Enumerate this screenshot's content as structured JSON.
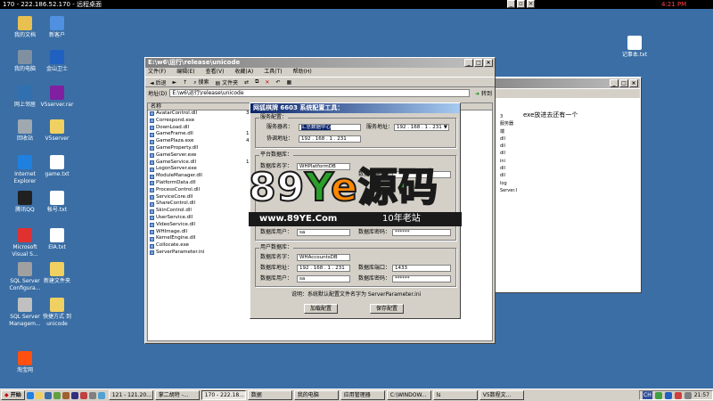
{
  "rdp": {
    "title": "170 - 222.186.52.170 - 远程桌面",
    "clock_red": "4:21 PM"
  },
  "desktop_icons": [
    {
      "label": "我的文档",
      "color": "#e8c050"
    },
    {
      "label": "新客户",
      "color": "#5090e0"
    },
    {
      "label": "我的电脑",
      "color": "#8090a0"
    },
    {
      "label": "金山卫士",
      "color": "#2060c0"
    },
    {
      "label": "网上邻居",
      "color": "#3070b0"
    },
    {
      "label": "V5server.rar",
      "color": "#8020a0"
    },
    {
      "label": "回收站",
      "color": "#a0a8b0"
    },
    {
      "label": "V5server",
      "color": "#f0d060"
    },
    {
      "label": "Internet\nExplorer",
      "color": "#2080e0"
    },
    {
      "label": "game.txt",
      "color": "#ffffff"
    },
    {
      "label": "腾讯QQ",
      "color": "#202020"
    },
    {
      "label": "帐号.txt",
      "color": "#ffffff"
    },
    {
      "label": "Microsoft\nVisual S...",
      "color": "#e03030"
    },
    {
      "label": "ElA.txt",
      "color": "#ffffff"
    },
    {
      "label": "SQL Server\nConfigura...",
      "color": "#a0a0a0"
    },
    {
      "label": "新建文件夹",
      "color": "#f0d060"
    },
    {
      "label": "SQL Server\nManagem...",
      "color": "#c0c0c0"
    },
    {
      "label": "快捷方式 到\nunicode",
      "color": "#f0d060"
    },
    {
      "label": "淘宝网",
      "color": "#ff5010"
    },
    {
      "label": "记事本.txt",
      "color": "#ffffff"
    }
  ],
  "explorer": {
    "title": "E:\\w6\\运行\\release\\unicode",
    "menu": [
      "文件(F)",
      "编辑(E)",
      "查看(V)",
      "收藏(A)",
      "工具(T)",
      "帮助(H)"
    ],
    "toolbar": {
      "back": "后退",
      "search": "搜索",
      "folders": "文件夹"
    },
    "address_label": "地址(D)",
    "address_value": "E:\\w6\\运行\\release\\unicode",
    "go_label": "转到",
    "column_name": "名称",
    "files": [
      "AvatarControl.dll",
      "Correspond.exe",
      "DownLoad.dll",
      "GameFrame.dll",
      "GamePlaza.exe",
      "GameProperty.dll",
      "GameServer.exe",
      "GameService.dll",
      "LogonServer.exe",
      "ModuleManager.dll",
      "PlatformData.dll",
      "ProcessControl.dll",
      "ServiceCore.dll",
      "ShareControl.dll",
      "SkinControl.dll",
      "UserService.dll",
      "VideoService.dll",
      "WHImage.dll",
      "KernelEngine.dll",
      "Collocate.exe",
      "ServerParameter.ini"
    ],
    "sizes_col": [
      "3,",
      "",
      "",
      "1,",
      "4,",
      "",
      "",
      "1,"
    ]
  },
  "right_window": {
    "text": "exe放进去还有一个",
    "side_items": [
      "3",
      "服务器端",
      "",
      "dll",
      "dll",
      "dll",
      "ini",
      "dll",
      "dll",
      "log",
      "Server.I"
    ]
  },
  "config": {
    "title": "网狐棋牌 6603 系统配置工具：",
    "server_group": "服务配置：",
    "server_name_label": "服务器名：",
    "server_name_value": "汇总数据中心",
    "server_addr_label": "服务地址：",
    "server_addr_value": "192 . 168 . 1 . 231",
    "coord_addr_label": "协调地址：",
    "coord_addr_value": "192 . 168 . 1 . 231",
    "platform_group": "平台数据库：",
    "db_name_label_1": "数据库名字：",
    "db_name_value_1": "WHPlatformDB",
    "db_port_label_1": "数据库端口：",
    "db_user_label_1": "数据库用户：",
    "db_user_value_1": "sa",
    "db_pass_label_1": "数据库密码：",
    "db_pass_value_1": "******",
    "user_group": "用户数据库：",
    "db_name_label_2": "数据库名字：",
    "db_name_value_2": "WHAccountsDB",
    "db_addr_label_2": "数据库地址：",
    "db_addr_value_2": "192 . 168 . 1 . 231",
    "db_port_label_2": "数据库端口：",
    "db_port_value_2": "1433",
    "db_user_label_2": "数据库用户：",
    "db_user_value_2": "sa",
    "db_pass_label_2": "数据库密码：",
    "db_pass_value_2": "******",
    "note": "说明：系统默认配置文件名字为 ServerParameter.ini",
    "load_button": "加载配置",
    "save_button": "保存配置"
  },
  "watermark": {
    "p1": "89",
    "p2": "Y",
    "p3": "e",
    "p4": "源码",
    "url": "www.89YE.Com",
    "tag": "10年老站"
  },
  "taskbar": {
    "start": "开始",
    "items": [
      "121 - 121.20...",
      "掌二胡特 -...",
      "170 - 222.18...",
      "数据",
      "我的电脑",
      "应用管理器",
      "C:\\WINDOW...",
      "ls",
      "V5数程文..."
    ],
    "active_index": 2,
    "lang": "CH",
    "clock": "21:57"
  },
  "colors": {
    "desktop": "#3a6ea5",
    "title_active": "#0a246a",
    "watermark_green": "#2aa02a",
    "watermark_orange": "#ff8800"
  }
}
